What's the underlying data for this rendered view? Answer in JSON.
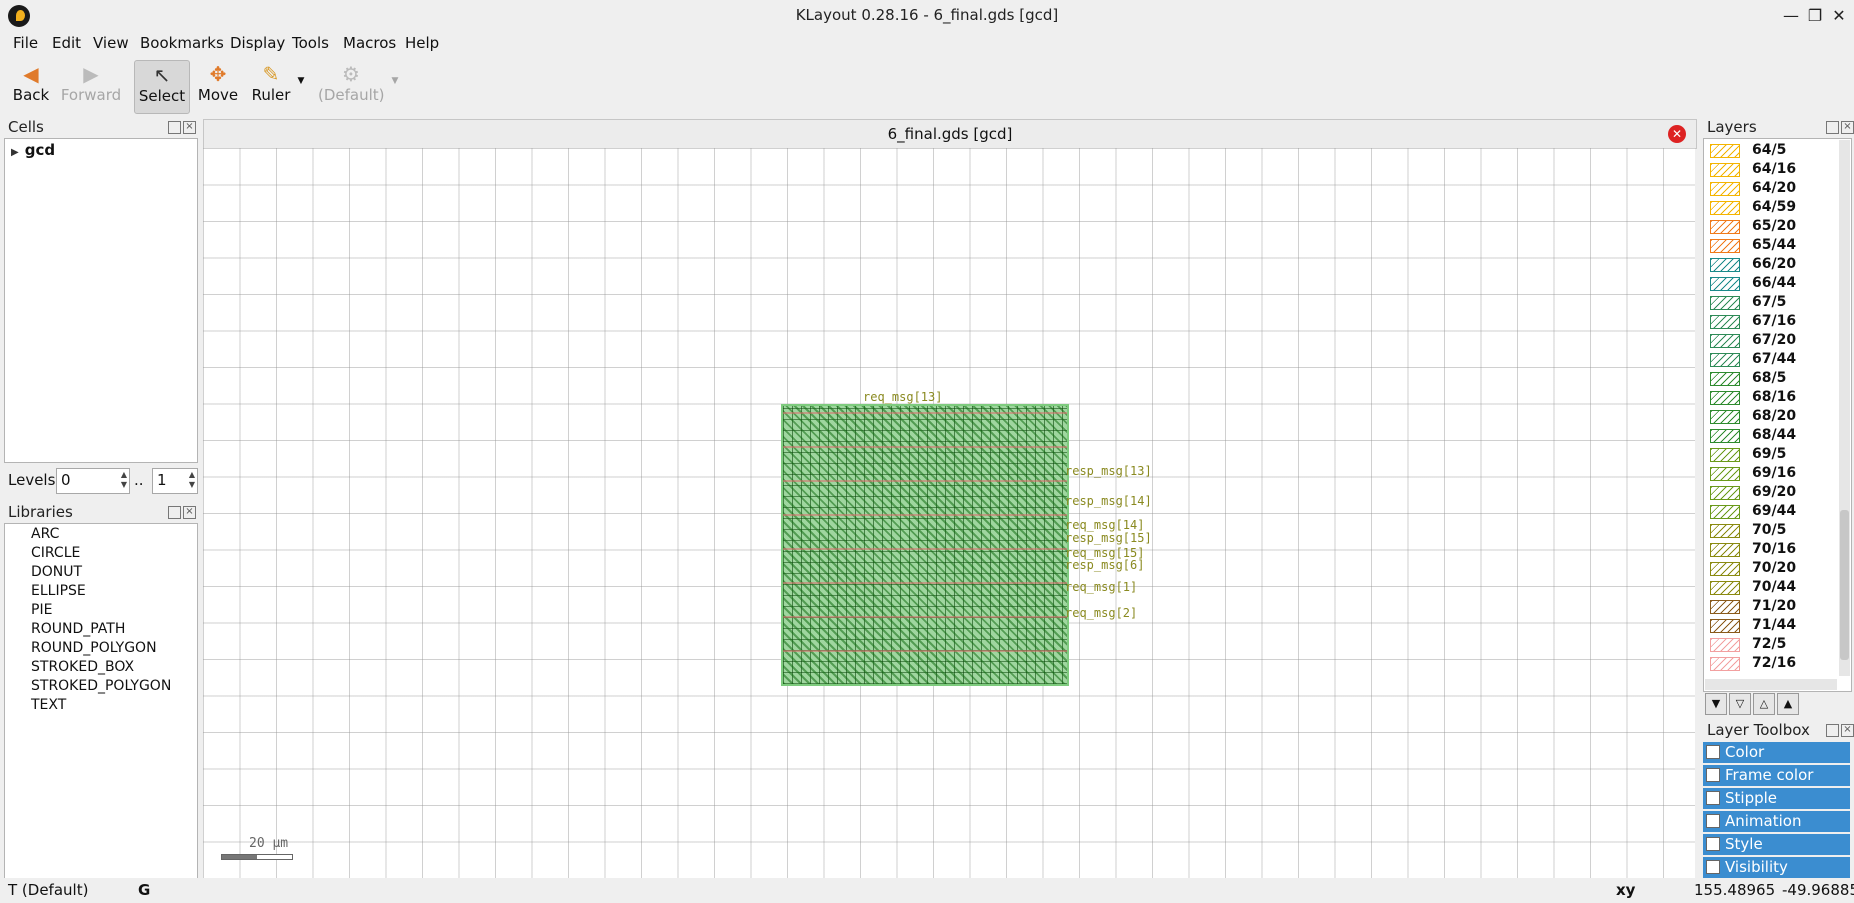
{
  "window": {
    "title": "KLayout 0.28.16 - 6_final.gds [gcd]",
    "minimize": "—",
    "restore": "❐",
    "close": "✕"
  },
  "menu": [
    "File",
    "Edit",
    "View",
    "Bookmarks",
    "Display",
    "Tools",
    "Macros",
    "Help"
  ],
  "toolbar": {
    "back": "Back",
    "forward": "Forward",
    "select": "Select",
    "move": "Move",
    "ruler": "Ruler",
    "default": "(Default)"
  },
  "cells": {
    "title": "Cells",
    "items": [
      "gcd"
    ]
  },
  "levels": {
    "label": "Levels",
    "from": "0",
    "sep": "..",
    "to": "1"
  },
  "libraries": {
    "title": "Libraries",
    "items": [
      "ARC",
      "CIRCLE",
      "DONUT",
      "ELLIPSE",
      "PIE",
      "ROUND_PATH",
      "ROUND_POLYGON",
      "STROKED_BOX",
      "STROKED_POLYGON",
      "TEXT"
    ]
  },
  "view": {
    "tab_title": "6_final.gds [gcd]",
    "scale_label": "20 µm"
  },
  "pins": {
    "top": "req_msg[13]",
    "labels": [
      "resp_msg[13]",
      "resp_msg[14]",
      "req_msg[14]",
      "resp_msg[15]",
      "req_msg[15]",
      "resp_msg[6]",
      "req_msg[1]",
      "req_msg[2]"
    ]
  },
  "layers": {
    "title": "Layers",
    "items": [
      {
        "name": "64/5",
        "color": "#f4b400"
      },
      {
        "name": "64/16",
        "color": "#f4b400"
      },
      {
        "name": "64/20",
        "color": "#f4b400"
      },
      {
        "name": "64/59",
        "color": "#f4b400"
      },
      {
        "name": "65/20",
        "color": "#f07a1a"
      },
      {
        "name": "65/44",
        "color": "#f07a1a"
      },
      {
        "name": "66/20",
        "color": "#1a8a8a"
      },
      {
        "name": "66/44",
        "color": "#1a8a8a"
      },
      {
        "name": "67/5",
        "color": "#2e8b57"
      },
      {
        "name": "67/16",
        "color": "#2e8b57"
      },
      {
        "name": "67/20",
        "color": "#2e8b57"
      },
      {
        "name": "67/44",
        "color": "#2e8b57"
      },
      {
        "name": "68/5",
        "color": "#2e8b2e"
      },
      {
        "name": "68/16",
        "color": "#2e8b2e"
      },
      {
        "name": "68/20",
        "color": "#2e8b2e"
      },
      {
        "name": "68/44",
        "color": "#2e8b2e"
      },
      {
        "name": "69/5",
        "color": "#6a9a1a"
      },
      {
        "name": "69/16",
        "color": "#6a9a1a"
      },
      {
        "name": "69/20",
        "color": "#6a9a1a"
      },
      {
        "name": "69/44",
        "color": "#6a9a1a"
      },
      {
        "name": "70/5",
        "color": "#8a8a10"
      },
      {
        "name": "70/16",
        "color": "#8a8a10"
      },
      {
        "name": "70/20",
        "color": "#8a8a10"
      },
      {
        "name": "70/44",
        "color": "#8a8a10"
      },
      {
        "name": "71/20",
        "color": "#8a5a1a"
      },
      {
        "name": "71/44",
        "color": "#8a5a1a"
      },
      {
        "name": "72/5",
        "color": "#f2a0a0"
      },
      {
        "name": "72/16",
        "color": "#f2a0a0"
      }
    ]
  },
  "layer_toolbox": {
    "title": "Layer Toolbox",
    "items": [
      "Color",
      "Frame color",
      "Stipple",
      "Animation",
      "Style",
      "Visibility"
    ]
  },
  "status": {
    "mode": "T (Default)",
    "grid": "G",
    "coord_label": "xy",
    "x": "155.48965",
    "y": "-49.96885"
  }
}
